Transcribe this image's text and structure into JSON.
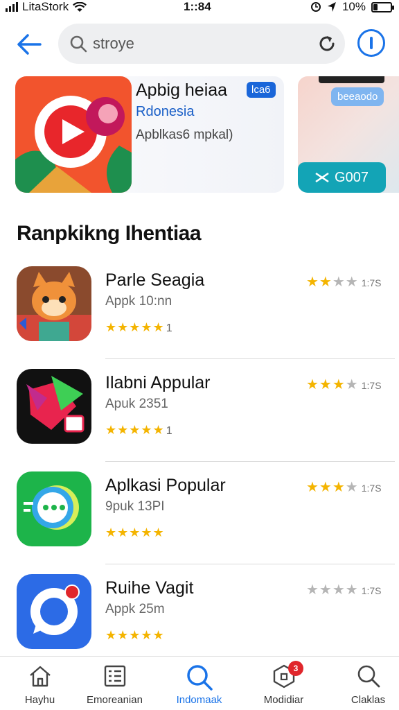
{
  "status_bar": {
    "carrier": "LitaStork",
    "time": "1::84",
    "battery": "10%",
    "battery_level": 0.25
  },
  "search": {
    "value": "stroye",
    "placeholder": "stroye"
  },
  "featured": {
    "title": "Apbig heiaa",
    "badge": "lca6",
    "subtitle": "Rdonesia",
    "description": "Apblkas6 mpkal)"
  },
  "promo": {
    "pill": "beeaodo",
    "button": "G007"
  },
  "section": {
    "title": "Ranpkikng Ihentiaa"
  },
  "apps": [
    {
      "name": "Parle Seagia",
      "size": "Appk 10:nn",
      "stars": "★★★★★",
      "review_count": "1",
      "rating_stars_on": "★★",
      "rating_stars_off": "★★",
      "rating_value": "1:7S"
    },
    {
      "name": "Ilabni Appular",
      "size": "Apuk 2351",
      "stars": "★★★★★",
      "review_count": "1",
      "rating_stars_on": "★★★",
      "rating_stars_off": "★",
      "rating_value": "1:7S"
    },
    {
      "name": "Aplkasi Popular",
      "size": "9puk 13PI",
      "stars": "★★★★★",
      "review_count": "",
      "rating_stars_on": "★★★",
      "rating_stars_off": "★",
      "rating_value": "1:7S"
    },
    {
      "name": "Ruihe Vagit",
      "size": "Appk 25m",
      "stars": "★★★★★",
      "review_count": "",
      "rating_stars_on": "",
      "rating_stars_off": "★★★★",
      "rating_value": "1:7S"
    }
  ],
  "nav": {
    "home": "Hayhu",
    "categories": "Emoreanian",
    "search": "Indomaak",
    "updates": "Modidiar",
    "updates_badge": "3",
    "account": "Claklas"
  },
  "colors": {
    "accent": "#1a73e8",
    "star": "#f4b400",
    "badge": "#e0262b",
    "promo": "#13a4b6"
  }
}
